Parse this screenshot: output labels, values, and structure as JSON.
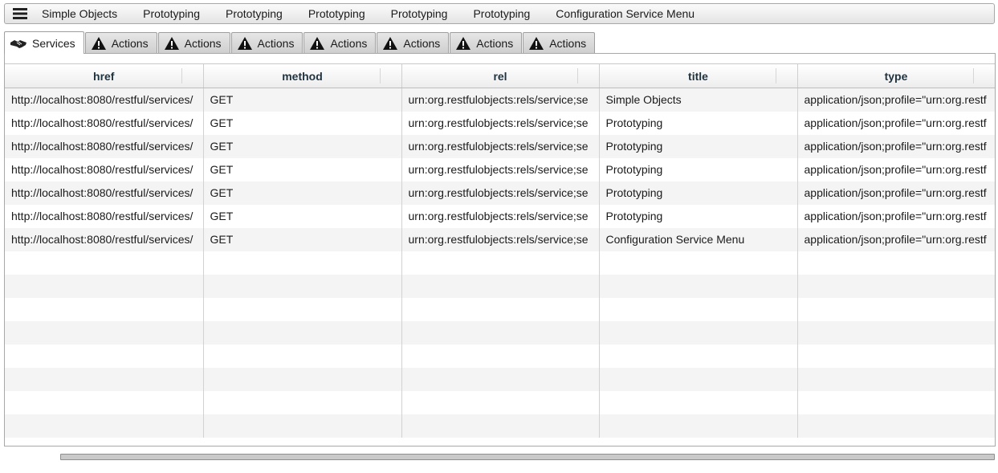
{
  "menubar": {
    "items": [
      "Simple Objects",
      "Prototyping",
      "Prototyping",
      "Prototyping",
      "Prototyping",
      "Prototyping",
      "Configuration Service Menu"
    ]
  },
  "tabs": [
    {
      "label": "Services",
      "icon": "handshake-icon",
      "active": true
    },
    {
      "label": "Actions",
      "icon": "warning-icon"
    },
    {
      "label": "Actions",
      "icon": "warning-icon"
    },
    {
      "label": "Actions",
      "icon": "warning-icon"
    },
    {
      "label": "Actions",
      "icon": "warning-icon"
    },
    {
      "label": "Actions",
      "icon": "warning-icon"
    },
    {
      "label": "Actions",
      "icon": "warning-icon"
    },
    {
      "label": "Actions",
      "icon": "warning-icon"
    }
  ],
  "grid": {
    "columns": [
      "href",
      "method",
      "rel",
      "title",
      "type"
    ],
    "rows": [
      [
        "http://localhost:8080/restful/services/",
        "GET",
        "urn:org.restfulobjects:rels/service;se",
        "Simple Objects",
        "application/json;profile=\"urn:org.restf"
      ],
      [
        "http://localhost:8080/restful/services/",
        "GET",
        "urn:org.restfulobjects:rels/service;se",
        "Prototyping",
        "application/json;profile=\"urn:org.restf"
      ],
      [
        "http://localhost:8080/restful/services/",
        "GET",
        "urn:org.restfulobjects:rels/service;se",
        "Prototyping",
        "application/json;profile=\"urn:org.restf"
      ],
      [
        "http://localhost:8080/restful/services/",
        "GET",
        "urn:org.restfulobjects:rels/service;se",
        "Prototyping",
        "application/json;profile=\"urn:org.restf"
      ],
      [
        "http://localhost:8080/restful/services/",
        "GET",
        "urn:org.restfulobjects:rels/service;se",
        "Prototyping",
        "application/json;profile=\"urn:org.restf"
      ],
      [
        "http://localhost:8080/restful/services/",
        "GET",
        "urn:org.restfulobjects:rels/service;se",
        "Prototyping",
        "application/json;profile=\"urn:org.restf"
      ],
      [
        "http://localhost:8080/restful/services/",
        "GET",
        "urn:org.restfulobjects:rels/service;se",
        "Configuration Service Menu",
        "application/json;profile=\"urn:org.restf"
      ]
    ],
    "empty_rows": 8
  }
}
